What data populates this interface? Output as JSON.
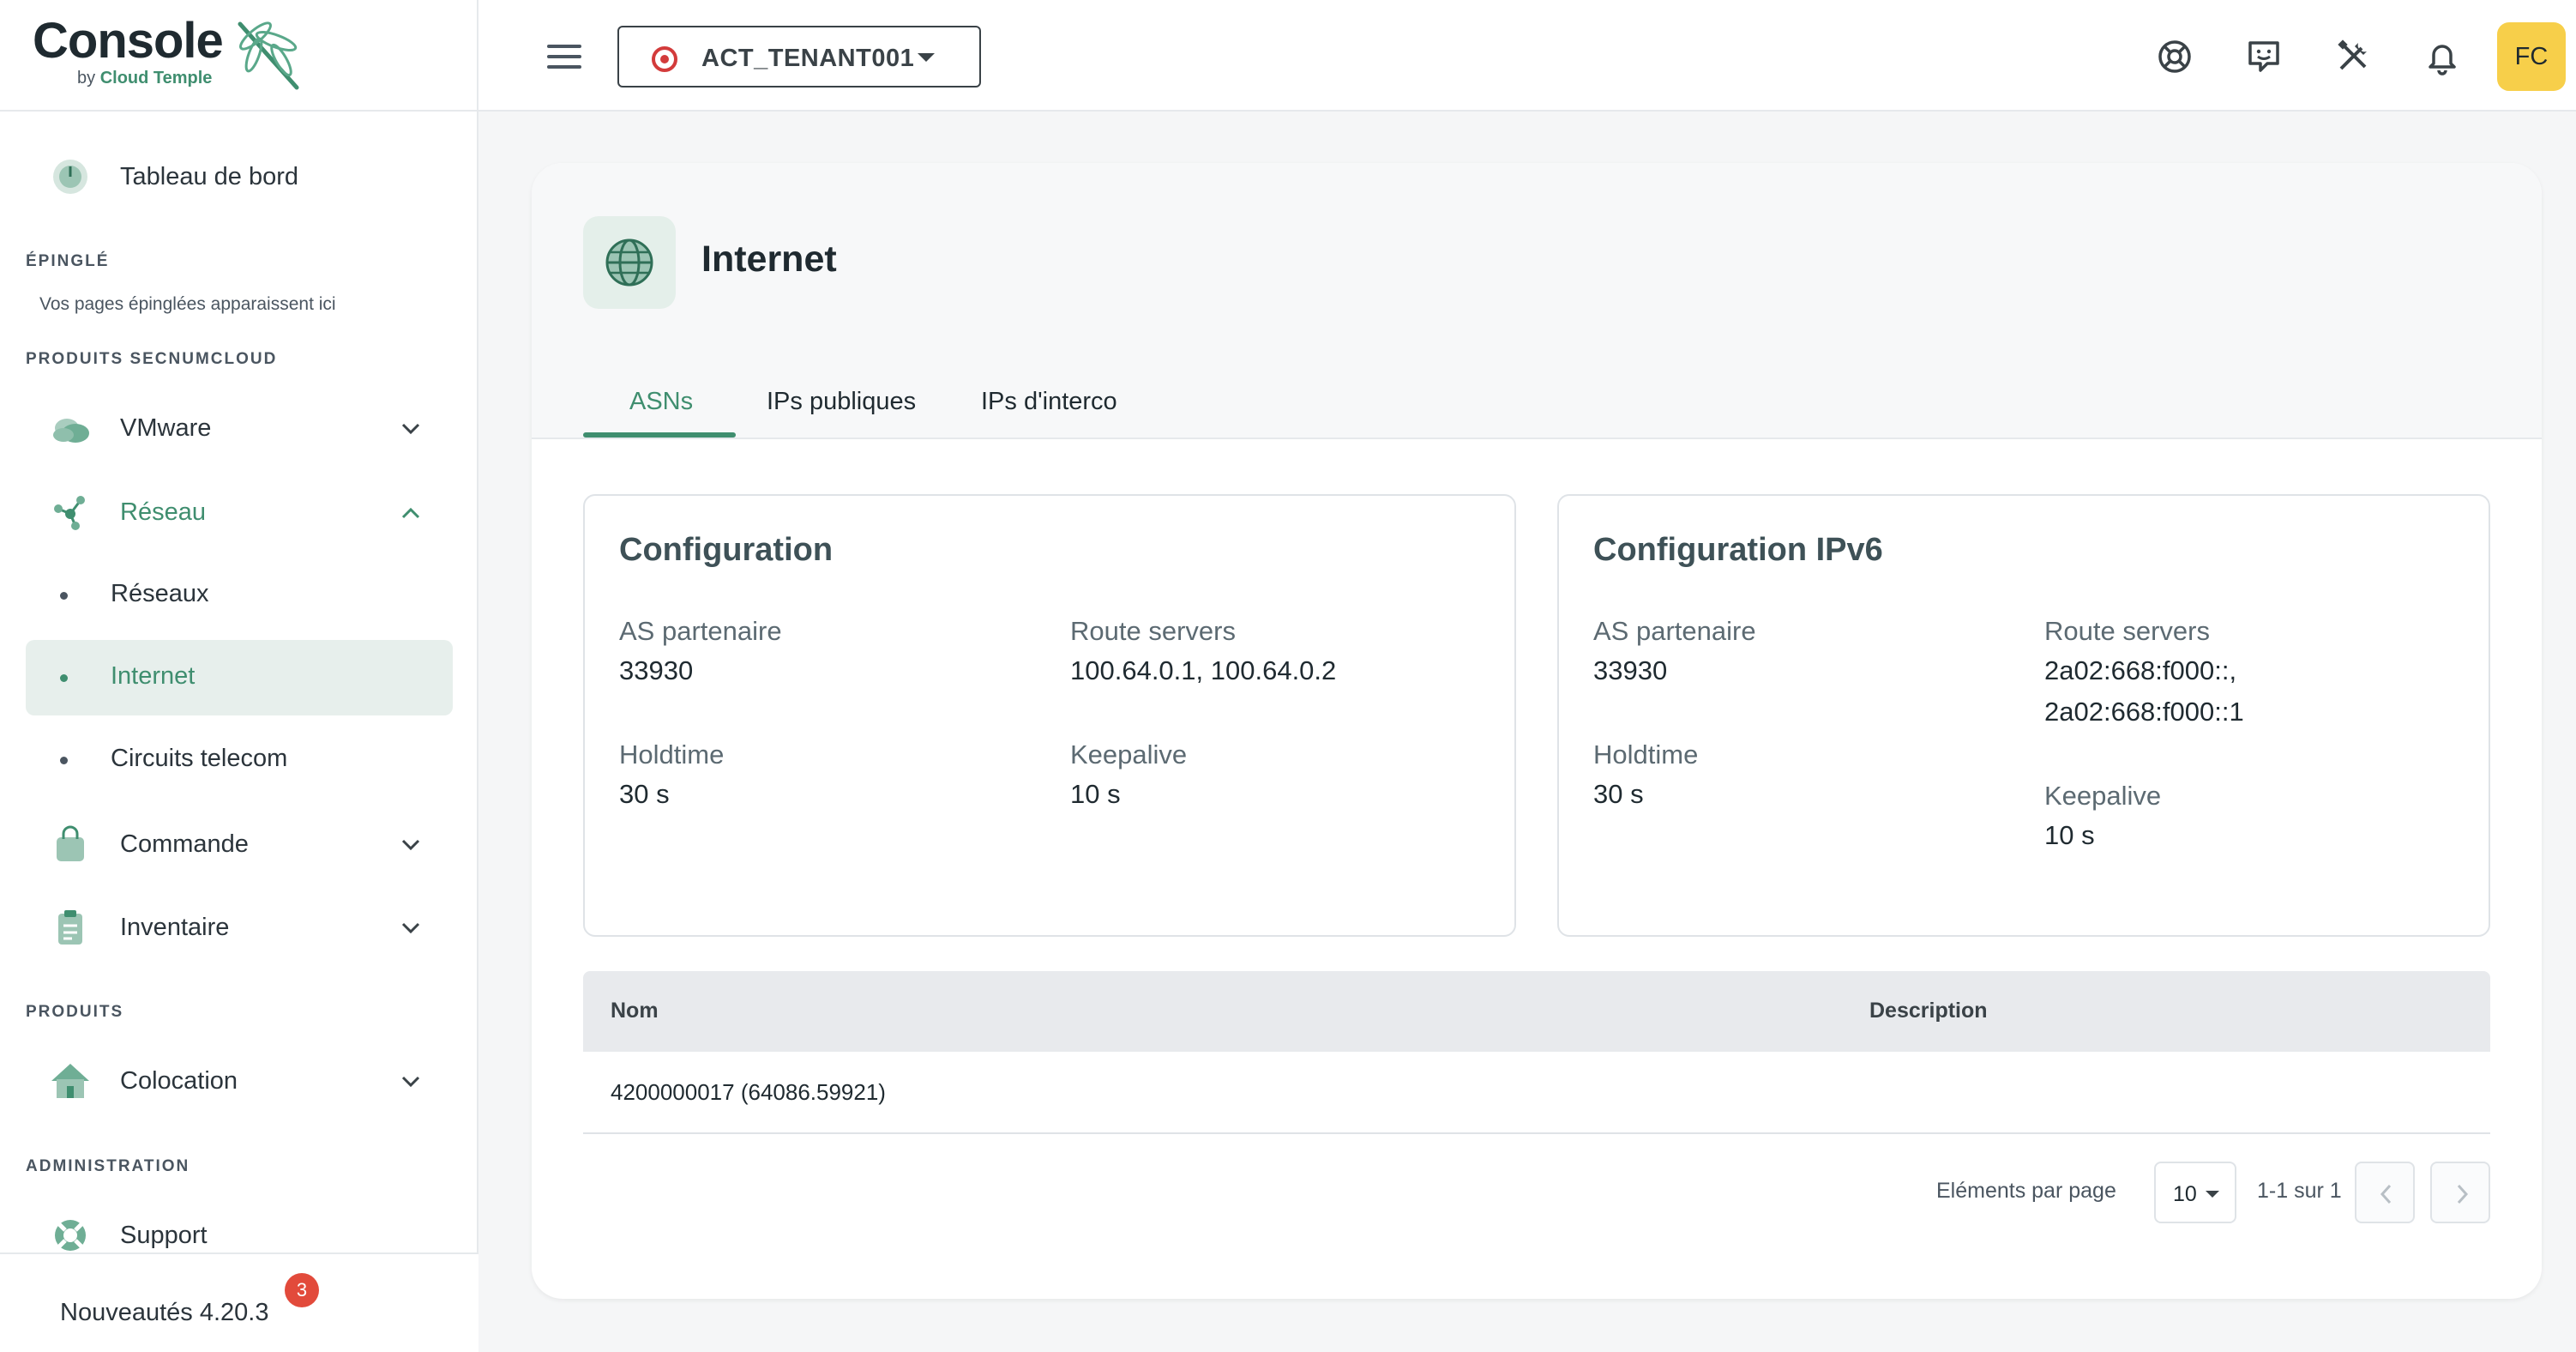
{
  "logo": {
    "title": "Console",
    "by": "by",
    "brand": "Cloud Temple"
  },
  "sidebar": {
    "dashboard": "Tableau de bord",
    "pinned_title": "ÉPINGLÉ",
    "pinned_hint": "Vos pages épinglées apparaissent ici",
    "secnum_title": "PRODUITS SECNUMCLOUD",
    "vmware": "VMware",
    "reseau": "Réseau",
    "reseau_items": [
      "Réseaux",
      "Internet",
      "Circuits telecom"
    ],
    "commande": "Commande",
    "inventaire": "Inventaire",
    "produits_title": "PRODUITS",
    "colocation": "Colocation",
    "admin_title": "ADMINISTRATION",
    "support": "Support",
    "news": "Nouveautés 4.20.3",
    "news_badge": "3"
  },
  "topbar": {
    "tenant": "ACT_TENANT001",
    "avatar": "FC",
    "icons": [
      "lifebuoy-icon",
      "feedback-icon",
      "tools-icon",
      "bell-icon"
    ]
  },
  "page": {
    "title": "Internet",
    "tabs": [
      "ASNs",
      "IPs publiques",
      "IPs d'interco"
    ],
    "active_tab": "ASNs"
  },
  "config": {
    "title": "Configuration",
    "as_label": "AS partenaire",
    "as_value": "33930",
    "route_label": "Route servers",
    "route_value": "100.64.0.1, 100.64.0.2",
    "hold_label": "Holdtime",
    "hold_value": "30 s",
    "keep_label": "Keepalive",
    "keep_value": "10 s"
  },
  "config6": {
    "title": "Configuration IPv6",
    "as_label": "AS partenaire",
    "as_value": "33930",
    "route_label": "Route servers",
    "route_value_1": "2a02:668:f000::,",
    "route_value_2": "2a02:668:f000::1",
    "hold_label": "Holdtime",
    "hold_value": "30 s",
    "keep_label": "Keepalive",
    "keep_value": "10 s"
  },
  "table": {
    "columns": [
      "Nom",
      "Description"
    ],
    "rows": [
      [
        "4200000017 (64086.59921)",
        ""
      ]
    ]
  },
  "pager": {
    "label": "Eléments par page",
    "per_page": "10",
    "range": "1-1 sur 1"
  },
  "colors": {
    "accent": "#3f8e6f",
    "badge": "#e24a3b",
    "avatar": "#f7cf4a"
  }
}
